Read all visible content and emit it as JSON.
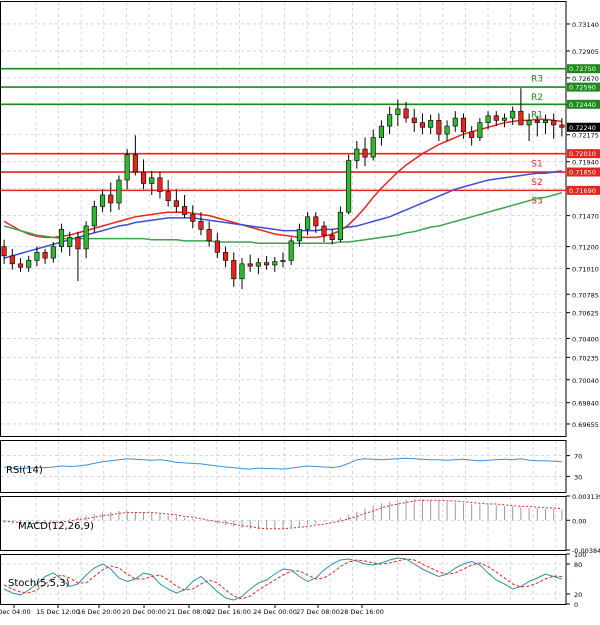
{
  "chart_data": [
    {
      "panel": "price",
      "type": "candlestick",
      "title": "",
      "y_ticks": [
        "0.73140",
        "0.72905",
        "0.72670",
        "0.72435",
        "0.72175",
        "0.71940",
        "0.71705",
        "0.71470",
        "0.71200",
        "0.71010",
        "0.70785",
        "0.70625",
        "0.70400",
        "0.70235",
        "0.70040",
        "0.69840",
        "0.69655"
      ],
      "ylim": [
        0.6955,
        0.7334
      ],
      "x_ticks": [
        "Dec 04:00",
        "15 Dec 12:00",
        "16 Dec 20:00",
        "20 Dec 00:00",
        "21 Dec 08:00",
        "22 Dec 16:00",
        "24 Dec 00:00",
        "27 Dec 08:00",
        "28 Dec 16:00"
      ],
      "candles": [
        [
          0.712,
          0.7126,
          0.7105,
          0.7112
        ],
        [
          0.7112,
          0.7118,
          0.71,
          0.7105
        ],
        [
          0.7105,
          0.711,
          0.7098,
          0.7102
        ],
        [
          0.7102,
          0.7112,
          0.7098,
          0.7108
        ],
        [
          0.7108,
          0.712,
          0.7103,
          0.7115
        ],
        [
          0.7115,
          0.7118,
          0.7105,
          0.711
        ],
        [
          0.711,
          0.7124,
          0.7106,
          0.712
        ],
        [
          0.712,
          0.714,
          0.7115,
          0.7135
        ],
        [
          0.712,
          0.7133,
          0.7112,
          0.7128
        ],
        [
          0.7128,
          0.7133,
          0.709,
          0.7118
        ],
        [
          0.7118,
          0.7142,
          0.711,
          0.7138
        ],
        [
          0.7138,
          0.716,
          0.7132,
          0.7155
        ],
        [
          0.7155,
          0.717,
          0.715,
          0.7165
        ],
        [
          0.7165,
          0.7176,
          0.715,
          0.7158
        ],
        [
          0.7158,
          0.7182,
          0.7152,
          0.7178
        ],
        [
          0.7178,
          0.7205,
          0.717,
          0.72
        ],
        [
          0.72,
          0.7217,
          0.7182,
          0.7185
        ],
        [
          0.7185,
          0.7196,
          0.717,
          0.7175
        ],
        [
          0.7175,
          0.7186,
          0.7165,
          0.718
        ],
        [
          0.718,
          0.7185,
          0.7162,
          0.7168
        ],
        [
          0.7168,
          0.7178,
          0.7155,
          0.716
        ],
        [
          0.716,
          0.717,
          0.715,
          0.7155
        ],
        [
          0.7155,
          0.7165,
          0.7145,
          0.7148
        ],
        [
          0.7148,
          0.7156,
          0.7136,
          0.7142
        ],
        [
          0.7142,
          0.715,
          0.713,
          0.7135
        ],
        [
          0.7135,
          0.7142,
          0.712,
          0.7125
        ],
        [
          0.7125,
          0.7132,
          0.711,
          0.7115
        ],
        [
          0.7115,
          0.712,
          0.7102,
          0.7108
        ],
        [
          0.7108,
          0.7115,
          0.7085,
          0.7092
        ],
        [
          0.7092,
          0.711,
          0.7083,
          0.7105
        ],
        [
          0.7105,
          0.7113,
          0.7098,
          0.7103
        ],
        [
          0.7103,
          0.711,
          0.7096,
          0.7106
        ],
        [
          0.7106,
          0.7112,
          0.71,
          0.7104
        ],
        [
          0.7104,
          0.7111,
          0.7098,
          0.7107
        ],
        [
          0.7107,
          0.7115,
          0.7102,
          0.7108
        ],
        [
          0.7108,
          0.7128,
          0.7104,
          0.7125
        ],
        [
          0.7125,
          0.714,
          0.712,
          0.7135
        ],
        [
          0.7135,
          0.715,
          0.713,
          0.7146
        ],
        [
          0.7146,
          0.715,
          0.7132,
          0.7138
        ],
        [
          0.7138,
          0.7142,
          0.7124,
          0.713
        ],
        [
          0.713,
          0.7135,
          0.7122,
          0.7126
        ],
        [
          0.7126,
          0.7155,
          0.7124,
          0.715
        ],
        [
          0.715,
          0.72,
          0.7148,
          0.7195
        ],
        [
          0.7195,
          0.7212,
          0.7188,
          0.7205
        ],
        [
          0.7205,
          0.7215,
          0.719,
          0.7198
        ],
        [
          0.7198,
          0.7222,
          0.7195,
          0.7215
        ],
        [
          0.7215,
          0.723,
          0.7208,
          0.7225
        ],
        [
          0.7225,
          0.7242,
          0.7218,
          0.7235
        ],
        [
          0.7235,
          0.7248,
          0.7225,
          0.724
        ],
        [
          0.724,
          0.7246,
          0.7228,
          0.7232
        ],
        [
          0.7232,
          0.724,
          0.722,
          0.7228
        ],
        [
          0.7228,
          0.7236,
          0.7218,
          0.7224
        ],
        [
          0.7224,
          0.7235,
          0.7218,
          0.723
        ],
        [
          0.723,
          0.7236,
          0.7212,
          0.7218
        ],
        [
          0.7218,
          0.723,
          0.7212,
          0.7225
        ],
        [
          0.7225,
          0.7238,
          0.722,
          0.7232
        ],
        [
          0.7232,
          0.7236,
          0.7214,
          0.722
        ],
        [
          0.722,
          0.7225,
          0.7208,
          0.7215
        ],
        [
          0.7215,
          0.7232,
          0.7212,
          0.7228
        ],
        [
          0.7228,
          0.7238,
          0.7222,
          0.7234
        ],
        [
          0.7234,
          0.7238,
          0.7225,
          0.723
        ],
        [
          0.723,
          0.7236,
          0.7224,
          0.7232
        ],
        [
          0.7232,
          0.7242,
          0.7226,
          0.7238
        ],
        [
          0.7238,
          0.7258,
          0.7232,
          0.7226
        ],
        [
          0.7226,
          0.7236,
          0.7212,
          0.723
        ],
        [
          0.723,
          0.7234,
          0.7216,
          0.7228
        ],
        [
          0.7228,
          0.7235,
          0.7218,
          0.723
        ],
        [
          0.723,
          0.7236,
          0.7214,
          0.7226
        ],
        [
          0.7226,
          0.7232,
          0.7216,
          0.7224
        ]
      ],
      "series": [
        {
          "color": "#e8251c",
          "values": [
            0.7142,
            0.7138,
            0.7134,
            0.7131,
            0.7129,
            0.7128,
            0.7128,
            0.7129,
            0.713,
            0.7132,
            0.7134,
            0.7136,
            0.7138,
            0.714,
            0.7142,
            0.7144,
            0.7146,
            0.7147,
            0.7148,
            0.7149,
            0.715,
            0.715,
            0.715,
            0.7149,
            0.7148,
            0.7147,
            0.7145,
            0.7143,
            0.7141,
            0.7139,
            0.7137,
            0.7135,
            0.7133,
            0.7131,
            0.713,
            0.7129,
            0.7128,
            0.7128,
            0.7128,
            0.7129,
            0.7131,
            0.7134,
            0.7139,
            0.7146,
            0.7154,
            0.7163,
            0.7171,
            0.7178,
            0.7185,
            0.7191,
            0.7196,
            0.7201,
            0.7205,
            0.7209,
            0.7212,
            0.7215,
            0.7218,
            0.722,
            0.7222,
            0.7224,
            0.7226,
            0.7228,
            0.7229,
            0.723,
            0.723,
            0.7231,
            0.7231,
            0.723,
            0.7229
          ]
        },
        {
          "color": "#3b4fd6",
          "values": [
            0.711,
            0.7112,
            0.7114,
            0.7116,
            0.7118,
            0.712,
            0.7122,
            0.7124,
            0.7126,
            0.7128,
            0.713,
            0.7132,
            0.7134,
            0.7136,
            0.7138,
            0.7139,
            0.7141,
            0.7142,
            0.7143,
            0.7144,
            0.7145,
            0.7145,
            0.7145,
            0.7145,
            0.7144,
            0.7143,
            0.7142,
            0.7141,
            0.714,
            0.7139,
            0.7138,
            0.7137,
            0.7136,
            0.7135,
            0.7134,
            0.7134,
            0.7134,
            0.7134,
            0.7134,
            0.7135,
            0.7135,
            0.7136,
            0.7137,
            0.7138,
            0.714,
            0.7142,
            0.7144,
            0.7146,
            0.7149,
            0.7152,
            0.7155,
            0.7158,
            0.7161,
            0.7164,
            0.7167,
            0.717,
            0.7172,
            0.7174,
            0.7176,
            0.7178,
            0.7179,
            0.718,
            0.7181,
            0.7182,
            0.7183,
            0.7184,
            0.7184,
            0.7185,
            0.7186
          ]
        },
        {
          "color": "#3aa64a",
          "values": [
            0.7138,
            0.7136,
            0.7134,
            0.7132,
            0.713,
            0.7129,
            0.7128,
            0.7127,
            0.7127,
            0.7127,
            0.7127,
            0.7127,
            0.7127,
            0.7127,
            0.7127,
            0.7127,
            0.7127,
            0.7127,
            0.7126,
            0.7126,
            0.7126,
            0.7126,
            0.7125,
            0.7125,
            0.7125,
            0.7125,
            0.7124,
            0.7124,
            0.7124,
            0.7124,
            0.7124,
            0.7123,
            0.7123,
            0.7123,
            0.7123,
            0.7123,
            0.7123,
            0.7123,
            0.7123,
            0.7123,
            0.7123,
            0.7124,
            0.7124,
            0.7125,
            0.7126,
            0.7127,
            0.7128,
            0.7129,
            0.713,
            0.7132,
            0.7133,
            0.7135,
            0.7137,
            0.7138,
            0.714,
            0.7142,
            0.7144,
            0.7146,
            0.7148,
            0.715,
            0.7152,
            0.7154,
            0.7156,
            0.7158,
            0.716,
            0.7162,
            0.7163,
            0.7165,
            0.7167
          ]
        }
      ],
      "levels": [
        {
          "label": "R3",
          "value": 0.7275,
          "value_text": "0.72750",
          "color": "#1b8a1b"
        },
        {
          "label": "R2",
          "value": 0.7259,
          "value_text": "0.72590",
          "color": "#1b8a1b"
        },
        {
          "label": "R1",
          "value": 0.7244,
          "value_text": "0.72440",
          "color": "#1b8a1b"
        },
        {
          "label": "S1",
          "value": 0.7201,
          "value_text": "0.72010",
          "color": "#e8251c"
        },
        {
          "label": "S2",
          "value": 0.7185,
          "value_text": "0.71850",
          "color": "#e8251c"
        },
        {
          "label": "S3",
          "value": 0.7169,
          "value_text": "0.71690",
          "color": "#e8251c"
        }
      ],
      "current_price": {
        "value": 0.7224,
        "text": "0.72240"
      }
    },
    {
      "panel": "rsi",
      "type": "line",
      "name": "RSI(14)",
      "y_ticks": [
        "70",
        "30"
      ],
      "ylim": [
        0,
        100
      ],
      "series": [
        {
          "color": "#3d8fd9",
          "values": [
            48,
            46,
            45,
            46,
            47,
            47,
            48,
            50,
            49,
            50,
            52,
            55,
            58,
            60,
            62,
            64,
            63,
            62,
            61,
            62,
            60,
            57,
            56,
            55,
            54,
            52,
            50,
            48,
            47,
            45,
            44,
            46,
            45,
            45,
            44,
            46,
            48,
            50,
            49,
            48,
            47,
            49,
            55,
            62,
            64,
            63,
            62,
            63,
            64,
            65,
            64,
            63,
            62,
            62,
            61,
            62,
            63,
            61,
            60,
            61,
            62,
            63,
            62,
            64,
            61,
            60,
            60,
            59,
            58
          ]
        }
      ]
    },
    {
      "panel": "macd",
      "type": "bar+line",
      "name": "MACD(12,26,9)",
      "y_ticks": [
        "0.003139",
        "0.00",
        "-0.00384"
      ],
      "ylim": [
        -0.00384,
        0.003139
      ],
      "histogram": [
        -0.0003,
        -0.0004,
        -0.0005,
        -0.0005,
        -0.0004,
        -0.0003,
        -0.0002,
        0.0,
        0.0002,
        0.0004,
        0.0006,
        0.0008,
        0.001,
        0.0011,
        0.0012,
        0.0012,
        0.0011,
        0.001,
        0.0009,
        0.0008,
        0.0006,
        0.0005,
        0.0003,
        0.0002,
        0.0,
        -0.0002,
        -0.0004,
        -0.0006,
        -0.0008,
        -0.001,
        -0.0011,
        -0.0012,
        -0.0012,
        -0.0011,
        -0.001,
        -0.0009,
        -0.0008,
        -0.0006,
        -0.0004,
        -0.0002,
        0.0,
        0.0003,
        0.0007,
        0.0011,
        0.0015,
        0.0019,
        0.0022,
        0.0024,
        0.0026,
        0.0027,
        0.0027,
        0.0027,
        0.0026,
        0.0025,
        0.0024,
        0.0023,
        0.0022,
        0.0021,
        0.002,
        0.0019,
        0.0019,
        0.0018,
        0.0018,
        0.0017,
        0.0016,
        0.0016,
        0.0015,
        0.0015,
        0.0014
      ],
      "signal": {
        "color": "#e8251c",
        "values": [
          -0.0001,
          -0.0002,
          -0.0003,
          -0.0004,
          -0.0004,
          -0.0004,
          -0.0003,
          -0.0002,
          -0.0001,
          0.0001,
          0.0002,
          0.0004,
          0.0006,
          0.0007,
          0.0009,
          0.001,
          0.001,
          0.001,
          0.001,
          0.0009,
          0.0008,
          0.0007,
          0.0005,
          0.0004,
          0.0002,
          0.0,
          -0.0002,
          -0.0003,
          -0.0005,
          -0.0007,
          -0.0008,
          -0.001,
          -0.0011,
          -0.0011,
          -0.0011,
          -0.001,
          -0.0009,
          -0.0008,
          -0.0006,
          -0.0005,
          -0.0003,
          -0.0001,
          0.0002,
          0.0005,
          0.0009,
          0.0012,
          0.0016,
          0.0019,
          0.0021,
          0.0023,
          0.0025,
          0.0026,
          0.0026,
          0.0026,
          0.0025,
          0.0025,
          0.0024,
          0.0023,
          0.0022,
          0.0021,
          0.0021,
          0.002,
          0.0019,
          0.0018,
          0.0018,
          0.0017,
          0.0016,
          0.0016,
          0.0015
        ]
      }
    },
    {
      "panel": "stoch",
      "type": "line",
      "name": "Stoch(5,5,3)",
      "y_ticks": [
        "100",
        "80",
        "20",
        "0"
      ],
      "ylim": [
        0,
        100
      ],
      "series": [
        {
          "color": "#2f8fb5",
          "dash": false,
          "values": [
            30,
            22,
            18,
            28,
            40,
            55,
            62,
            50,
            35,
            40,
            58,
            72,
            80,
            70,
            52,
            45,
            50,
            62,
            58,
            40,
            30,
            22,
            28,
            45,
            55,
            40,
            25,
            12,
            8,
            15,
            30,
            42,
            48,
            60,
            70,
            68,
            55,
            45,
            52,
            68,
            80,
            88,
            90,
            86,
            80,
            78,
            82,
            88,
            92,
            90,
            80,
            70,
            62,
            55,
            60,
            72,
            80,
            85,
            78,
            62,
            48,
            40,
            30,
            35,
            45,
            52,
            60,
            55,
            50
          ]
        },
        {
          "color": "#e8251c",
          "dash": true,
          "values": [
            38,
            30,
            24,
            22,
            28,
            40,
            52,
            58,
            52,
            42,
            42,
            55,
            68,
            76,
            72,
            60,
            50,
            50,
            55,
            58,
            48,
            36,
            28,
            30,
            40,
            48,
            42,
            28,
            16,
            10,
            16,
            28,
            38,
            48,
            58,
            66,
            66,
            58,
            50,
            52,
            62,
            75,
            84,
            88,
            86,
            82,
            80,
            82,
            86,
            90,
            88,
            80,
            72,
            64,
            60,
            62,
            70,
            78,
            82,
            75,
            64,
            52,
            40,
            34,
            36,
            42,
            50,
            56,
            55
          ]
        }
      ]
    }
  ]
}
